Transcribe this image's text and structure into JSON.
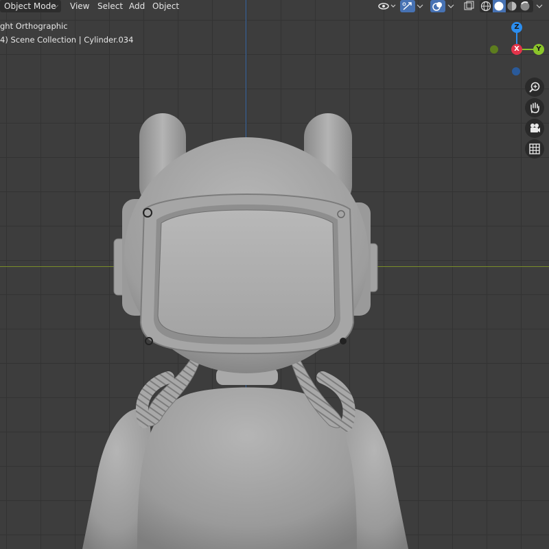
{
  "header": {
    "mode_label": "Object Mode",
    "menus": {
      "view": "View",
      "select": "Select",
      "add": "Add",
      "object": "Object"
    }
  },
  "overlay": {
    "view_name": "ght Orthographic",
    "collection_info": "4) Scene Collection | Cylinder.034"
  },
  "gizmo": {
    "z_label": "Z",
    "x_label": "X",
    "y_label": "Y",
    "colors": {
      "x": "#e2334a",
      "y": "#8bc52a",
      "z": "#2b8ef0",
      "neg_y": "#5d7d1e",
      "neg_z": "#2a5a9a"
    }
  },
  "nav_icons": [
    "zoom-icon",
    "hand-pan-icon",
    "camera-icon",
    "grid-icon"
  ]
}
